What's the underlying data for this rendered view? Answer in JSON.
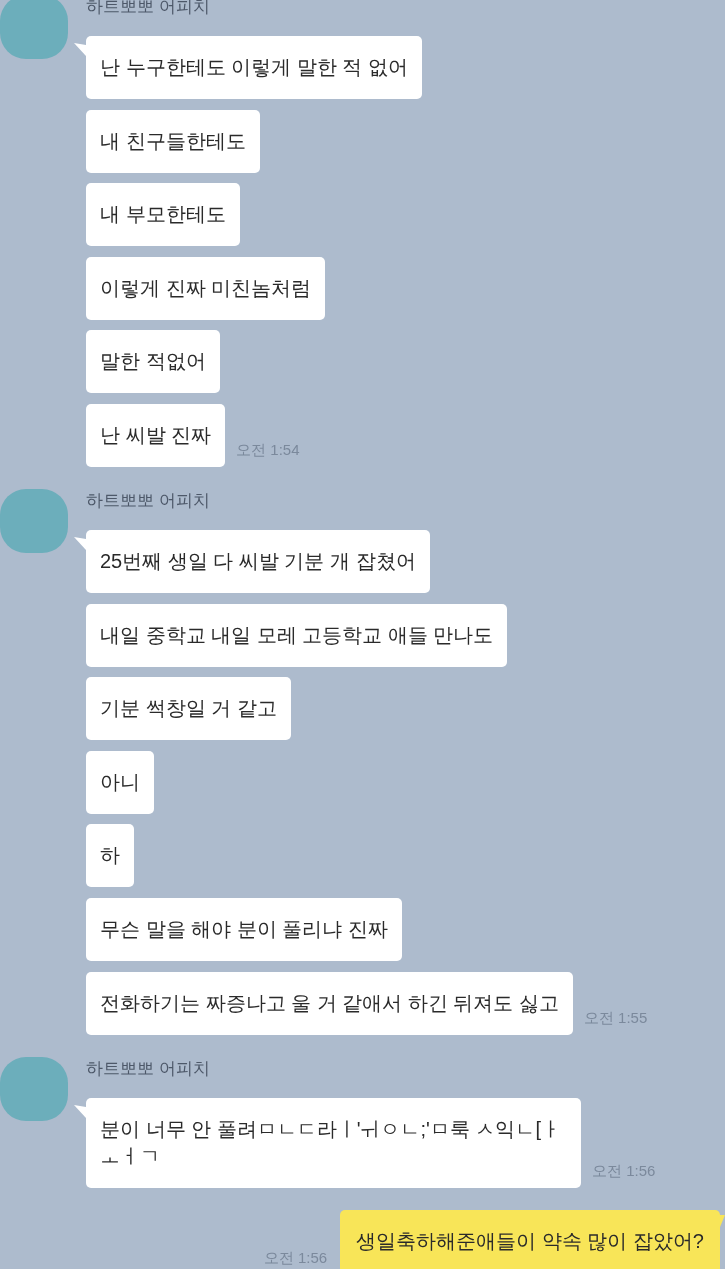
{
  "messages": [
    {
      "kind": "received",
      "sender": "하트뽀뽀 어피치",
      "bubbles": [
        "난 누구한테도 이렇게 말한 적 없어",
        "내 친구들한테도",
        "내 부모한테도",
        "이렇게 진짜 미친놈처럼",
        "말한 적없어",
        "난 씨발 진짜"
      ],
      "time": "오전 1:54"
    },
    {
      "kind": "received",
      "sender": "하트뽀뽀 어피치",
      "bubbles": [
        "25번째 생일 다 씨발 기분 개 잡쳤어",
        "내일 중학교 내일 모레 고등학교 애들 만나도",
        "기분 썩창일 거 같고",
        "아니",
        "하",
        "무슨 말을 해야 분이 풀리냐 진짜",
        "전화하기는 짜증나고 울 거 같애서 하긴 뒤져도 싫고"
      ],
      "time": "오전 1:55"
    },
    {
      "kind": "received",
      "sender": "하트뽀뽀 어피치",
      "bubbles": [
        "분이 너무 안 풀려ㅁㄴㄷ라ㅣ'ㅟㅇㄴ;'ㅁ룩 ㅅ익ㄴ[ㅏㅗㅓㄱ"
      ],
      "time": "오전 1:56"
    },
    {
      "kind": "sent",
      "bubbles": [
        "생일축하해준애들이 약속 많이 잡았어?"
      ],
      "time": "오전 1:56"
    }
  ]
}
